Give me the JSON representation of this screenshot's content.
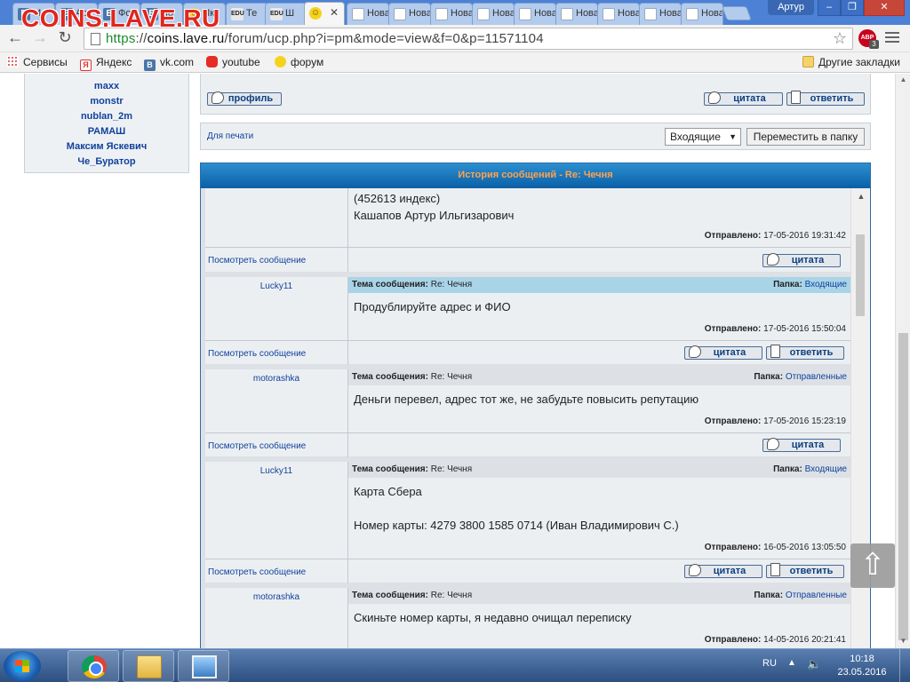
{
  "browser": {
    "watermark": "COINS.LAVE.RU",
    "tabs": [
      {
        "title": "М",
        "icon": "vk-icon"
      },
      {
        "title": "Ар",
        "icon": "vk-icon"
      },
      {
        "title": "Фо",
        "icon": "vk-icon"
      },
      {
        "title": "По",
        "icon": "vk-icon"
      },
      {
        "title": "Лк",
        "icon": "smile-icon"
      },
      {
        "title": "Те",
        "icon": "edu-icon"
      },
      {
        "title": "Ш",
        "icon": "edu-icon"
      },
      {
        "title": "",
        "icon": "smile-icon",
        "active": true
      },
      {
        "title": "Новая",
        "icon": "doc-icon"
      },
      {
        "title": "Новая",
        "icon": "doc-icon"
      },
      {
        "title": "Новая",
        "icon": "doc-icon"
      },
      {
        "title": "Новая",
        "icon": "doc-icon"
      },
      {
        "title": "Новая",
        "icon": "doc-icon"
      },
      {
        "title": "Новая",
        "icon": "doc-icon"
      },
      {
        "title": "Новая",
        "icon": "doc-icon"
      },
      {
        "title": "Новая",
        "icon": "doc-icon"
      },
      {
        "title": "Нова",
        "icon": "doc-icon"
      }
    ],
    "user_name": "Артур",
    "url_scheme": "https",
    "url_host": "coins.lave.ru",
    "url_path": "/forum/ucp.php?i=pm&mode=view&f=0&p=11571104",
    "abp_label": "ABP",
    "abp_count": "3",
    "bookmarks": [
      {
        "label": "Сервисы",
        "icon": "apps-icon"
      },
      {
        "label": "Яндекс",
        "icon": "yandex-icon"
      },
      {
        "label": "vk.com",
        "icon": "vk-icon"
      },
      {
        "label": "youtube",
        "icon": "youtube-icon"
      },
      {
        "label": "форум",
        "icon": "smile-icon"
      }
    ],
    "other_bookmarks": "Другие закладки"
  },
  "sidebar": {
    "users": [
      "maxx",
      "monstr",
      "nublan_2m",
      "РАМАШ",
      "Максим Яскевич",
      "Че_Буратор"
    ]
  },
  "top_panel": {
    "profile_button": "профиль",
    "quote_button": "цитата",
    "reply_button": "ответить"
  },
  "print_panel": {
    "print_link": "Для печати",
    "folder_select": "Входящие",
    "move_button": "Переместить в папку"
  },
  "history": {
    "title": "История сообщений - Re: Чечня",
    "labels": {
      "subject": "Тема сообщения:",
      "folder": "Папка:",
      "sent": "Отправлено:",
      "view": "Посмотреть сообщение",
      "quote": "цитата",
      "reply": "ответить"
    },
    "first_partial": {
      "lines": [
        "(452613 индекс)",
        "Кашапов Артур Ильгизарович"
      ],
      "sent": "17-05-2016 19:31:42"
    },
    "messages": [
      {
        "author": "Lucky11",
        "subject": "Re: Чечня",
        "folder": "Входящие",
        "highlight": true,
        "text": [
          "Продублируйте адрес и ФИО"
        ],
        "sent": "17-05-2016 15:50:04",
        "reply": true
      },
      {
        "author": "motorashka",
        "subject": "Re: Чечня",
        "folder": "Отправленные",
        "highlight": false,
        "text": [
          "Деньги перевел, адрес тот же, не забудьте повысить репутацию"
        ],
        "sent": "17-05-2016 15:23:19",
        "reply": false
      },
      {
        "author": "Lucky11",
        "subject": "Re: Чечня",
        "folder": "Входящие",
        "highlight": false,
        "text": [
          "Карта Сбера",
          "",
          "Номер карты: 4279 3800 1585 0714 (Иван Владимирович С.)"
        ],
        "sent": "16-05-2016 13:05:50",
        "reply": true
      },
      {
        "author": "motorashka",
        "subject": "Re: Чечня",
        "folder": "Отправленные",
        "highlight": false,
        "text": [
          "Скиньте номер карты, я недавно очищал переписку"
        ],
        "sent": "14-05-2016 20:21:41",
        "reply": false
      }
    ]
  },
  "taskbar": {
    "language": "RU",
    "time": "10:18",
    "date": "23.05.2016"
  }
}
